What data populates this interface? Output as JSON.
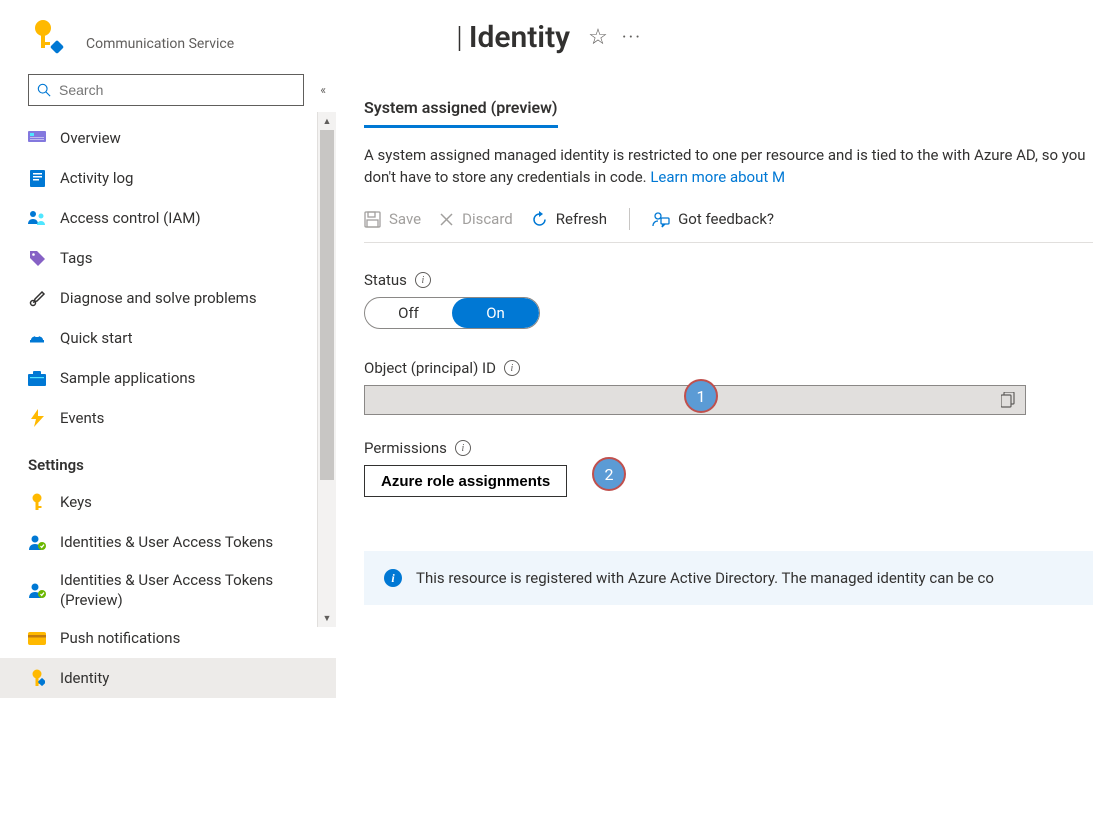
{
  "header": {
    "service_type": "Communication Service",
    "title_separator": "|",
    "title": "Identity",
    "star_glyph": "☆",
    "more_glyph": "···"
  },
  "sidebar": {
    "search_placeholder": "Search",
    "collapse_glyph": "«",
    "nav": [
      {
        "icon": "overview-icon",
        "label": "Overview"
      },
      {
        "icon": "activity-log-icon",
        "label": "Activity log"
      },
      {
        "icon": "access-control-icon",
        "label": "Access control (IAM)"
      },
      {
        "icon": "tags-icon",
        "label": "Tags"
      },
      {
        "icon": "diagnose-icon",
        "label": "Diagnose and solve problems"
      },
      {
        "icon": "quick-start-icon",
        "label": "Quick start"
      },
      {
        "icon": "sample-apps-icon",
        "label": "Sample applications"
      },
      {
        "icon": "events-icon",
        "label": "Events"
      }
    ],
    "section_header": "Settings",
    "settings": [
      {
        "icon": "keys-icon",
        "label": "Keys"
      },
      {
        "icon": "identities-icon",
        "label": "Identities & User Access Tokens"
      },
      {
        "icon": "identities-preview-icon",
        "label": "Identities & User Access Tokens (Preview)"
      },
      {
        "icon": "push-icon",
        "label": "Push notifications"
      },
      {
        "icon": "identity-icon",
        "label": "Identity",
        "selected": true
      }
    ]
  },
  "main": {
    "tab_label": "System assigned (preview)",
    "description_text": "A system assigned managed identity is restricted to one per resource and is tied to the with Azure AD, so you don't have to store any credentials in code. ",
    "description_link": "Learn more about M",
    "toolbar": {
      "save": "Save",
      "discard": "Discard",
      "refresh": "Refresh",
      "feedback": "Got feedback?"
    },
    "status_label": "Status",
    "toggle_off": "Off",
    "toggle_on": "On",
    "object_id_label": "Object (principal) ID",
    "object_id_value": "",
    "permissions_label": "Permissions",
    "role_button": "Azure role assignments",
    "banner_text": "This resource is registered with Azure Active Directory. The managed identity can be co"
  },
  "annotations": {
    "badge1": "1",
    "badge2": "2"
  }
}
